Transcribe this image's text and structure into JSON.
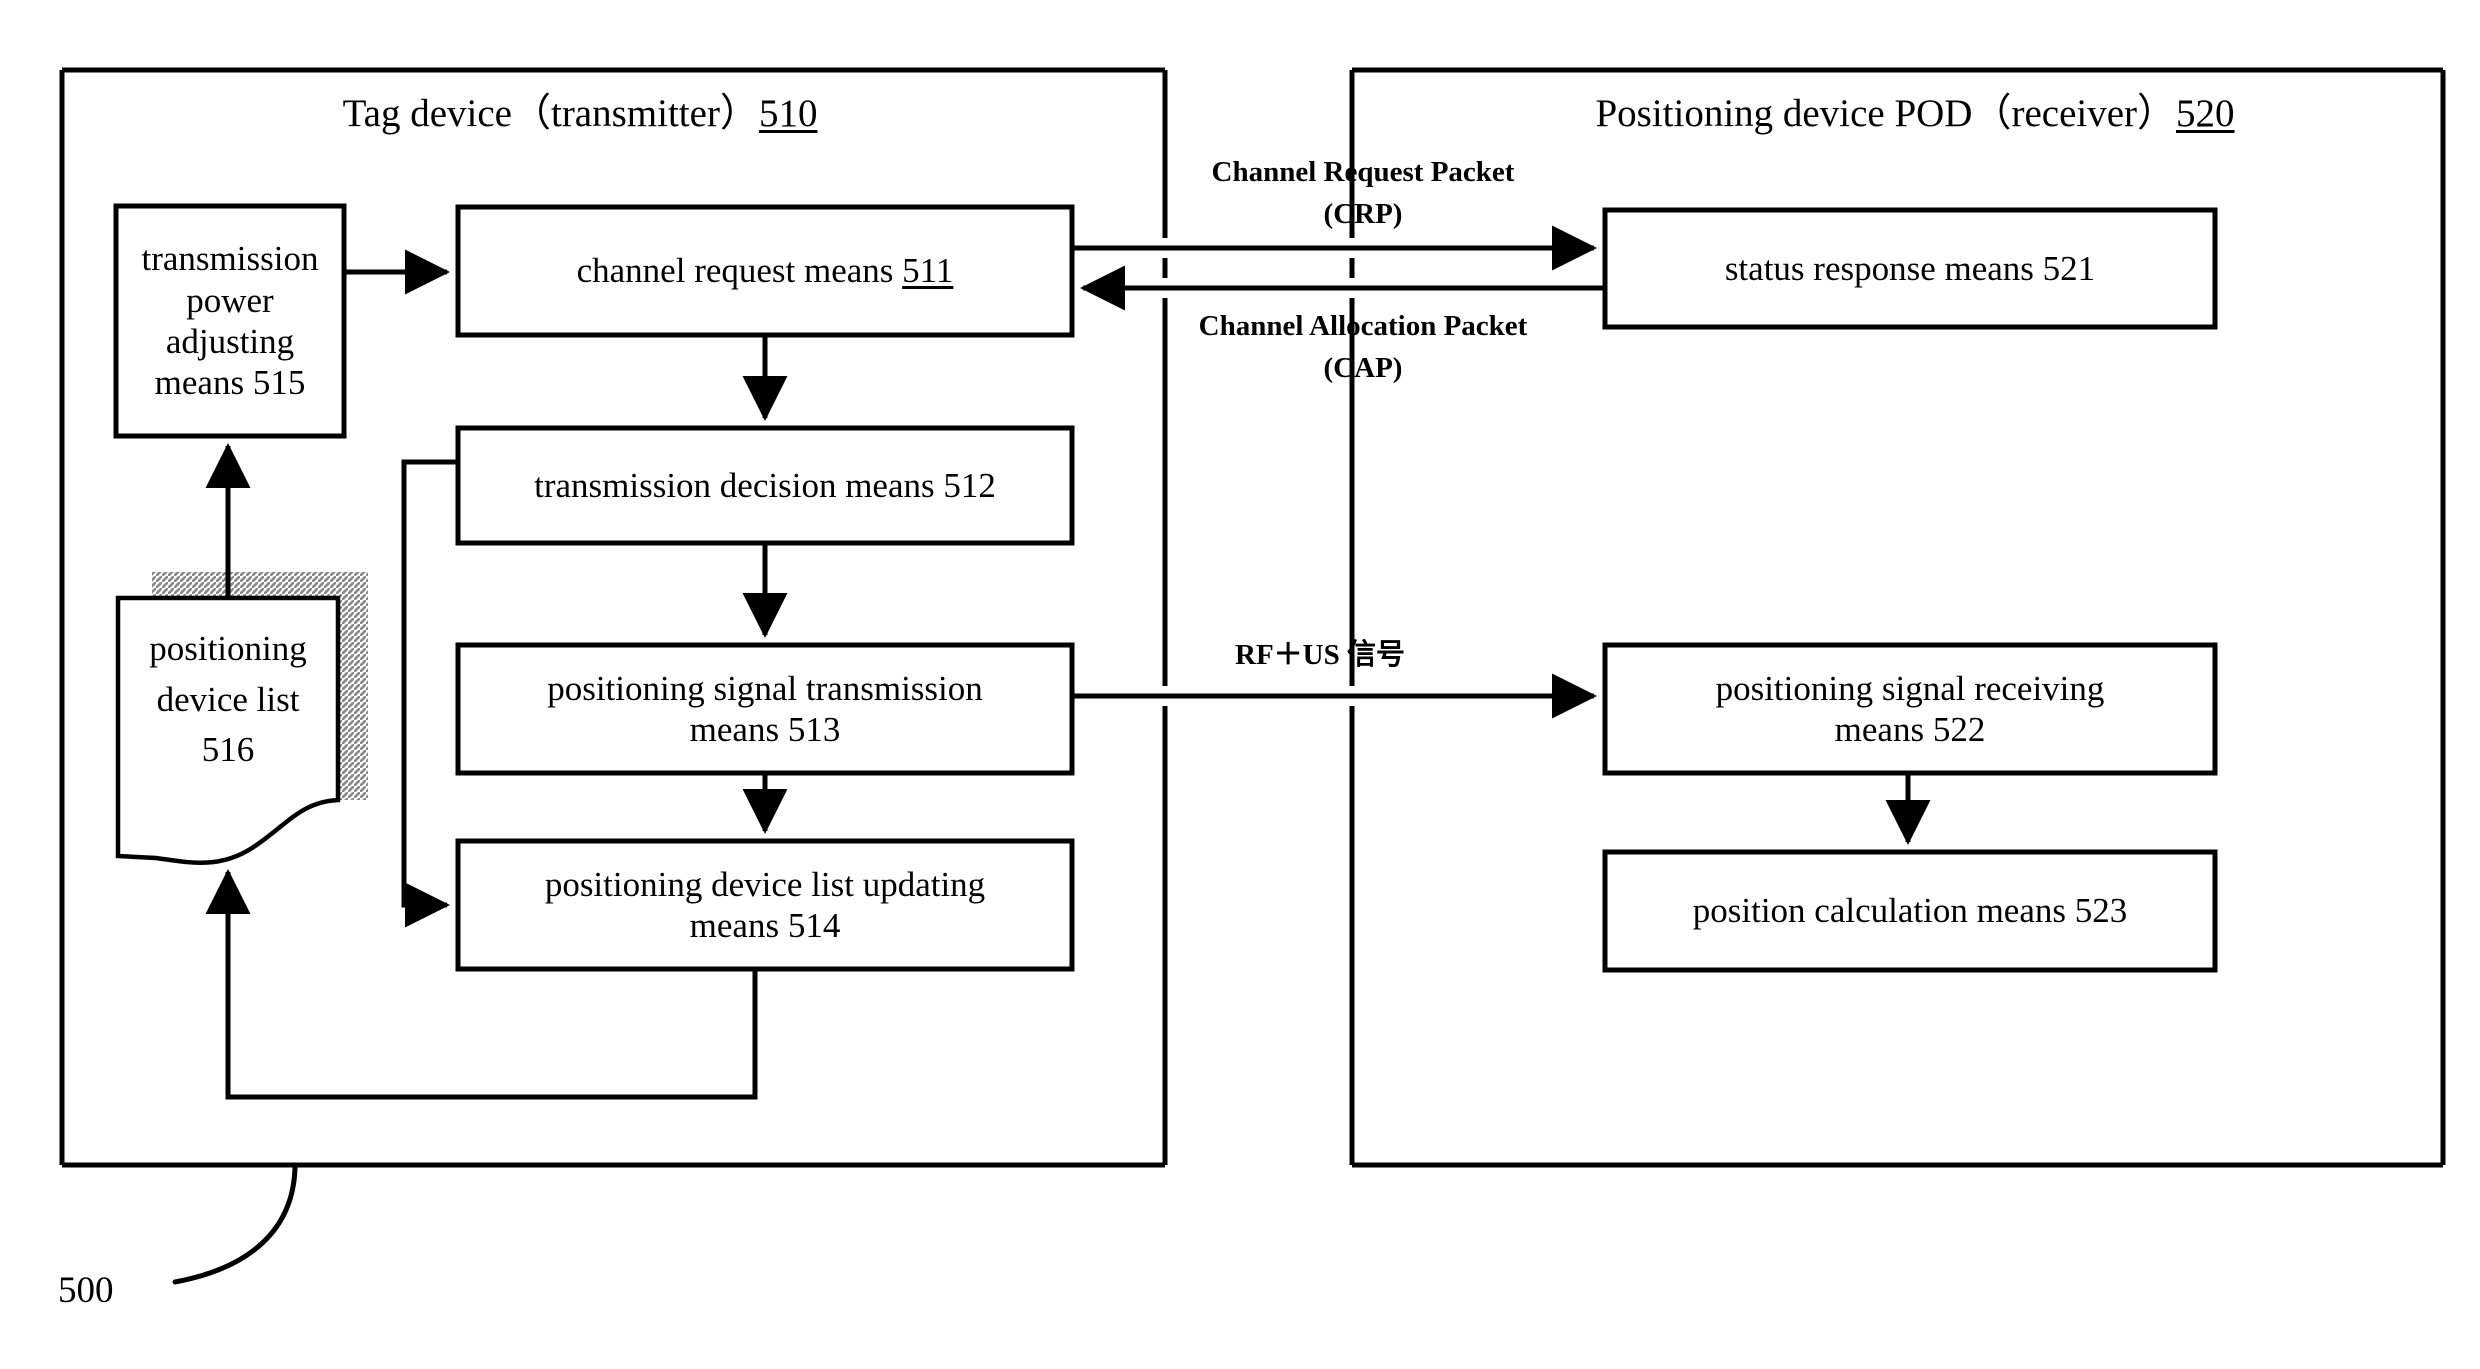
{
  "figure": {
    "number": "500"
  },
  "containers": [
    {
      "id": "tag-device",
      "title_main": "Tag device（transmitter）",
      "title_ref": "510"
    },
    {
      "id": "positioning-device",
      "title_main": "Positioning device POD（receiver）",
      "title_ref": "520"
    }
  ],
  "blocks": {
    "transmission_power_adjusting": "transmission\npower\nadjusting\nmeans 515",
    "positioning_device_list": "positioning\ndevice list\n516",
    "channel_request_main": "channel request means ",
    "channel_request_ref": "511",
    "transmission_decision": "transmission decision means 512",
    "positioning_signal_transmission": "positioning signal transmission\nmeans 513",
    "positioning_device_list_updating": "positioning device list updating\nmeans 514",
    "status_response": "status response means 521",
    "positioning_signal_receiving": "positioning signal receiving\nmeans 522",
    "position_calculation": "position calculation means 523"
  },
  "link_labels": {
    "crp": "Channel Request Packet\n(CRP)",
    "cap": "Channel Allocation Packet\n(CAP)",
    "rf_us": "RF＋US 信号"
  },
  "colors": {
    "stroke": "#000000",
    "background": "#ffffff",
    "shadow_hatch": "#8a8a8a"
  }
}
